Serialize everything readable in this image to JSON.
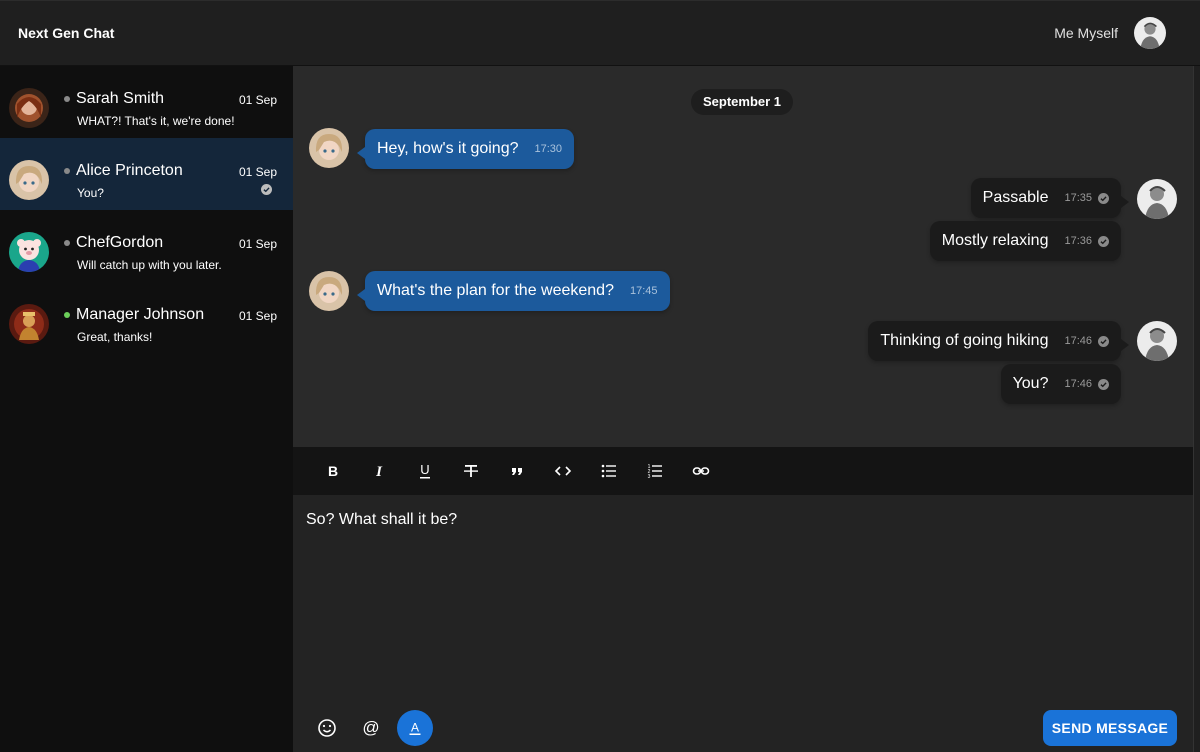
{
  "app": {
    "title": "Next Gen Chat"
  },
  "user": {
    "name": "Me Myself",
    "avatar_icon": "user-avatar"
  },
  "colors": {
    "accent": "#1a73d8",
    "incoming_bubble": "#1c5a9c",
    "outgoing_bubble": "#1b1b1b",
    "online": "#6ccf5a",
    "active_conversation": "#14263a"
  },
  "conversations": [
    {
      "name": "Sarah Smith",
      "date": "01 Sep",
      "preview": "WHAT?! That's it, we're done!",
      "online": false,
      "active": false,
      "read": false
    },
    {
      "name": "Alice Princeton",
      "date": "01 Sep",
      "preview": "You?",
      "online": false,
      "active": true,
      "read": true
    },
    {
      "name": "ChefGordon",
      "date": "01 Sep",
      "preview": "Will catch up with you later.",
      "online": false,
      "active": false,
      "read": false
    },
    {
      "name": "Manager Johnson",
      "date": "01 Sep",
      "preview": "Great, thanks!",
      "online": true,
      "active": false,
      "read": false
    }
  ],
  "chat": {
    "date_separator": "September 1",
    "messages": [
      {
        "direction": "in",
        "text": "Hey, how's it going?",
        "time": "17:30"
      },
      {
        "direction": "out",
        "text": "Passable",
        "time": "17:35"
      },
      {
        "direction": "out",
        "text": "Mostly relaxing",
        "time": "17:36"
      },
      {
        "direction": "in",
        "text": "What's the plan for the weekend?",
        "time": "17:45"
      },
      {
        "direction": "out",
        "text": "Thinking of going hiking",
        "time": "17:46"
      },
      {
        "direction": "out",
        "text": "You?",
        "time": "17:46"
      }
    ]
  },
  "toolbar": {
    "tools": [
      "bold-icon",
      "italic-icon",
      "underline-icon",
      "strikethrough-icon",
      "quote-icon",
      "code-icon",
      "bullet-list-icon",
      "numbered-list-icon",
      "link-icon"
    ]
  },
  "composer": {
    "text": "So? What shall it be?",
    "buttons": [
      "emoji-icon",
      "mention-icon",
      "text-format-icon"
    ],
    "send_label": "SEND MESSAGE"
  }
}
